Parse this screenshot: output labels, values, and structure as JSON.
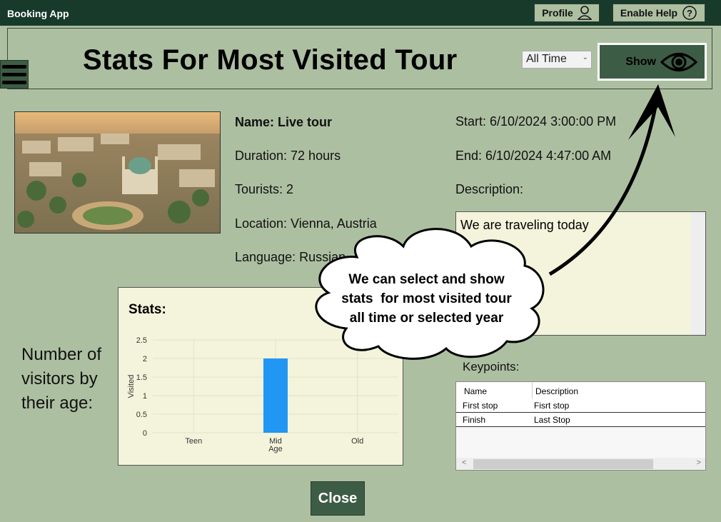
{
  "app": {
    "title": "Booking App"
  },
  "titlebar": {
    "profile_label": "Profile",
    "help_label": "Enable Help",
    "profile_icon": "person-icon",
    "help_icon": "question-circle-icon"
  },
  "header": {
    "title": "Stats For Most Visited Tour",
    "period_select_value": "All Time",
    "show_label": "Show",
    "show_icon": "eye-icon"
  },
  "tour": {
    "name": "Name: Live tour",
    "duration": "Duration: 72 hours",
    "tourists": "Tourists: 2",
    "location": "Location: Vienna, Austria",
    "language": "Language: Russian",
    "start": "Start: 6/10/2024 3:00:00 PM",
    "end": "End: 6/10/2024 4:47:00 AM",
    "description_label": "Description:",
    "description_text": "We are traveling today"
  },
  "stats": {
    "heading": "Stats:",
    "side_label_lines": [
      "Number of",
      "visitors by",
      "their age:"
    ]
  },
  "chart_data": {
    "type": "bar",
    "categories": [
      "Teen",
      "Mid Age",
      "Old"
    ],
    "category_label_lines": [
      [
        "Teen"
      ],
      [
        "Mid",
        "Age"
      ],
      [
        "Old"
      ]
    ],
    "values": [
      0,
      2,
      0
    ],
    "ylabel": "Visited",
    "xlabel": "",
    "ylim": [
      0,
      2.5
    ],
    "yticks": [
      "0",
      "0.5",
      "1",
      "1.5",
      "2",
      "2.5"
    ],
    "bar_color": "#2196f3",
    "grid": true
  },
  "keypoints": {
    "label": "Keypoints:",
    "columns": [
      "Name",
      "Description"
    ],
    "rows": [
      [
        "First stop",
        "Fisrt stop"
      ],
      [
        "Finish",
        "Last Stop"
      ]
    ]
  },
  "help_bubble": {
    "lines": [
      "We can select and show",
      "stats  for most visited tour",
      "all time or selected year"
    ]
  },
  "footer": {
    "close_label": "Close"
  },
  "colors": {
    "background": "#adbfa1",
    "titlebar": "#173a2b",
    "button": "#3d5c45",
    "panel": "#f4f4dc"
  }
}
